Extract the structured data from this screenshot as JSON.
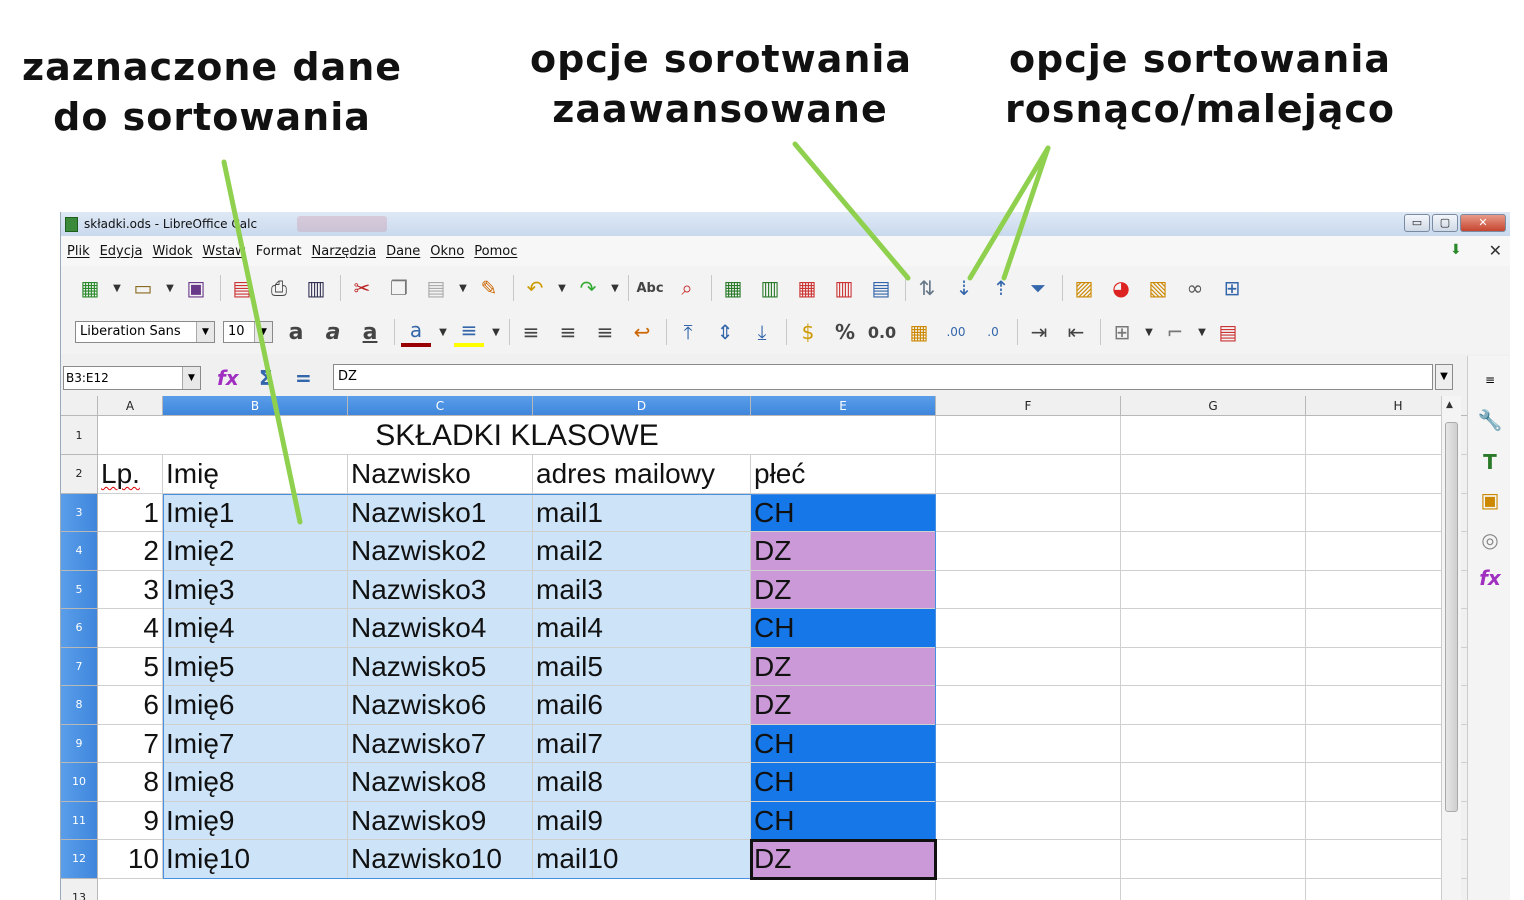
{
  "annotations": {
    "left": [
      "zaznaczone dane",
      "do sortowania"
    ],
    "middle": [
      "opcje sorotwania",
      "zaawansowane"
    ],
    "right": [
      "opcje sortowania",
      "rosnąco/malejąco"
    ]
  },
  "window": {
    "title": "składki.ods - LibreOffice Calc",
    "controls": {
      "minimize": "▭",
      "maximize": "▢",
      "close": "✕"
    }
  },
  "menu": [
    "Plik",
    "Edycja",
    "Widok",
    "Wstaw",
    "Format",
    "Narzędzia",
    "Dane",
    "Okno",
    "Pomoc"
  ],
  "format_toolbar": {
    "font_name": "Liberation Sans",
    "font_size": "10",
    "bold": "a",
    "italic": "a",
    "underline": "a",
    "percent": "%",
    "number": "0.0"
  },
  "formula_bar": {
    "name_box": "B3:E12",
    "formula": "DZ",
    "sum_icon": "Σ",
    "equals_icon": "="
  },
  "sheet": {
    "columns": [
      "A",
      "B",
      "C",
      "D",
      "E",
      "F",
      "G",
      "H"
    ],
    "rows": [
      "1",
      "2",
      "3",
      "4",
      "5",
      "6",
      "7",
      "8",
      "9",
      "10",
      "11",
      "12",
      "13"
    ],
    "title": "SKŁADKI KLASOWE",
    "headers": [
      "Lp.",
      "Imię",
      "Nazwisko",
      "adres mailowy",
      "płeć"
    ],
    "data": [
      [
        "1",
        "Imię1",
        "Nazwisko1",
        "mail1",
        "CH"
      ],
      [
        "2",
        "Imię2",
        "Nazwisko2",
        "mail2",
        "DZ"
      ],
      [
        "3",
        "Imię3",
        "Nazwisko3",
        "mail3",
        "DZ"
      ],
      [
        "4",
        "Imię4",
        "Nazwisko4",
        "mail4",
        "CH"
      ],
      [
        "5",
        "Imię5",
        "Nazwisko5",
        "mail5",
        "DZ"
      ],
      [
        "6",
        "Imię6",
        "Nazwisko6",
        "mail6",
        "DZ"
      ],
      [
        "7",
        "Imię7",
        "Nazwisko7",
        "mail7",
        "CH"
      ],
      [
        "8",
        "Imię8",
        "Nazwisko8",
        "mail8",
        "CH"
      ],
      [
        "9",
        "Imię9",
        "Nazwisko9",
        "mail9",
        "CH"
      ],
      [
        "10",
        "Imię10",
        "Nazwisko10",
        "mail10",
        "DZ"
      ]
    ]
  },
  "colors": {
    "selection": "#cce3f8",
    "ch_fill": "#1577e8",
    "dz_fill": "#cb99d8",
    "header_selected": "#4a90e2",
    "annotation_line": "#8fd14f"
  }
}
